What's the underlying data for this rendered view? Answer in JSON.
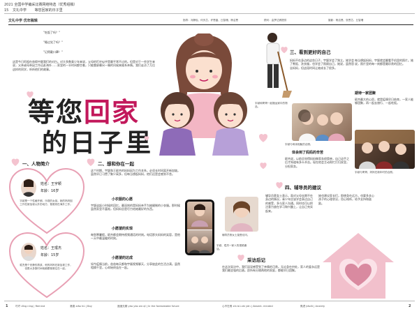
{
  "header": {
    "top_line": "2021 全国中学编采比赛网络特选（优秀组稿）",
    "page_num": "15",
    "school_name": "文礼中学",
    "title_mini": "等您回家的日子里",
    "issue_title": "文礼中学 优年稿辑",
    "team_left": "指导：冯静怡、何天芯、许恩晶、丘智珊、杨洁恩",
    "team_mid": "顾问：由梦达睿提供",
    "team_right": "摄影：杨洁恩、张思芯、丘智珊"
  },
  "intro": {
    "quote1": "\"吃饭了吗？\"",
    "quote2": "\"睡过觉了吗？\"",
    "quote3": "\"记得戴口罩！\"",
    "body": "这是今日阿祖在休假中跟我们的对白。对大多数青少年来说，父母的叮咛似乎是最平常不过的。但是对于一些学生来说，父亲或母亲因工作远赴海外……家里的一半时间都空着，只能靠屏幕另一端的问候来维系亲情。我们走访了几位这样的同学，听听他们的故事。"
  },
  "title": {
    "line1a": "等您",
    "line1b": "回家",
    "line2": "的日子里"
  },
  "people": {
    "section": "一、人物简介",
    "p1_name": "姓名：王宇颖",
    "p1_age": "年龄：16岁",
    "p1_desc": "宇颖是一个性格开朗、乐观的女孩。她的妈妈因工作在新加坡以外的地方，爸爸则在海外工作。",
    "p2_name": "姓名：王珉杰",
    "p2_age": "年龄：15岁",
    "p2_desc": "珉杰是个安静的男孩，他的妈妈在新加坡工作，但是大多数时间他都跟爸爸住在一起。"
  },
  "missing": {
    "section": "二、想和你在一起",
    "body": "这个时期，宇颖和王珉杰的妈妈因为工作关系，必须长时间离开新加坡。虽然早已习惯了聚少离多，但每当想起妈妈，他们还是会感到不舍。",
    "sub1": "小衣服的心愿",
    "sub1_body": "宇颖谈起小时候的回忆，最深刻的是妈妈亲手为她缝制的小衣服。那时候虽然家里不富裕，但妈妈总是尽力给她最好的东西。",
    "sub2": "小愿望的实现",
    "sub2_body": "每到寒暑假，珉杰都会期待视频通话的时刻。电话那头妈妈的笑容，是他一天中最温暖的时刻。",
    "sub3": "小愿望的达成",
    "sub3_body": "如今疫情当前，爸爸每天都和宇颖视频聊天，分享彼此的生活点滴。虽然相隔千里，心却始终连在一起。"
  },
  "together": {
    "section": "三、看到更好的自己",
    "body": "妈妈不在身边的这些日子，宇颖学会了独立。她学会了煮饭、洗衣服，也学会了照顾自己。她说，虽然思念妈妈，但这段时间让她成长了很多。",
    "caption1": "宇颖和哥哥一起搬运家中的物品。",
    "caption2": "宇颖与母亲相聚的合照。",
    "sub": "体会到了妈妈的辛苦",
    "sub_body": "珉杰说，以前总觉得妈妈做家务很简单，自己动手之后才知道有多么辛苦。现在他会主动帮忙打扫家里，分担家务。",
    "right_body": "每当想起妈妈，宇颖就会翻看手机里的照片。她说，照片里的每一刻都是最珍贵的回忆。",
    "right_sub": "期待一家团聚",
    "right_sub_body": "珉杰最大的心愿，就是疫情早日结束，一家人能够团聚，再一起去旅行、一起吃饭。",
    "caption3": "宇颖与哥哥、妈妈在新年时的合照。"
  },
  "advice": {
    "section": "四、辅导员的建议",
    "body": "辅导员蔡女士表示，面对父母长期不在身边的情况，青少年应该学会表达自己的感受，多与家人沟通。同时也可以把注意力放在学习和兴趣上，让自己充实起来。",
    "right_body": "她也建议家长们，即使身在远方，也要多关心孩子的心理状况，用心倾听，给予支持和鼓励。",
    "caption": "辅导员蔡女士接受访问。"
  },
  "afterword": {
    "section": "采访后记",
    "body": "在这次采访中，我们深深感受到了亲情的可贵。无论身在何处，家人的爱永远是我们最坚强的后盾。愿所有分隔两地的家庭，都能早日团聚。"
  },
  "phone_caption": "宇颖、珉杰一家人的视频通话。",
  "footer": {
    "left_num": "1",
    "w1": "叮咛 dīng níng | Remind",
    "w2": "港澳 xiāo hú | Bay",
    "w3": "遥遥无期 yáo yáo wú qī | In the foreseeable future",
    "w4": "心不在焉 xīn bú zài yān | Absent- minded",
    "w5": "焦虑 jiāolǜ | Anxiety",
    "right_num": "2"
  }
}
